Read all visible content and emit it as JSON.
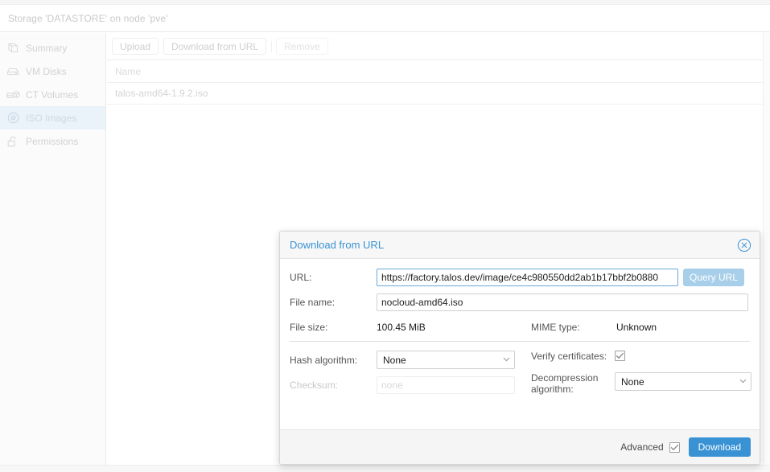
{
  "window": {
    "page_title": "Storage 'DATASTORE' on node 'pve'"
  },
  "sidebar": {
    "items": [
      {
        "label": "Summary",
        "icon": "summary-icon",
        "selected": false
      },
      {
        "label": "VM Disks",
        "icon": "harddrive-icon",
        "selected": false
      },
      {
        "label": "CT Volumes",
        "icon": "ct-volume-icon",
        "selected": false
      },
      {
        "label": "ISO Images",
        "icon": "disc-icon",
        "selected": true
      },
      {
        "label": "Permissions",
        "icon": "unlock-icon",
        "selected": false
      }
    ]
  },
  "toolbar": {
    "upload_label": "Upload",
    "download_url_label": "Download from URL",
    "remove_label": "Remove"
  },
  "table": {
    "columns": [
      "Name"
    ],
    "rows": [
      {
        "name": "talos-amd64-1.9.2.iso"
      }
    ]
  },
  "dialog": {
    "title": "Download from URL",
    "close_icon": "close-circle-icon",
    "url": {
      "label": "URL:",
      "value": "https://factory.talos.dev/image/ce4c980550dd2ab1b17bbf2b0880",
      "query_button": "Query URL"
    },
    "file_name": {
      "label": "File name:",
      "value": "nocloud-amd64.iso"
    },
    "file_size": {
      "label": "File size:",
      "value": "100.45 MiB"
    },
    "mime_type": {
      "label": "MIME type:",
      "value": "Unknown"
    },
    "hash_algorithm": {
      "label": "Hash algorithm:",
      "value": "None"
    },
    "checksum": {
      "label": "Checksum:",
      "placeholder": "none",
      "value": ""
    },
    "verify_certificates": {
      "label": "Verify certificates:",
      "checked": true
    },
    "decompression_algorithm": {
      "label": "Decompression algorithm:",
      "value": "None"
    },
    "footer": {
      "advanced_label": "Advanced",
      "advanced_checked": true,
      "download_label": "Download"
    }
  },
  "colors": {
    "accent": "#3892d4",
    "accent_light": "#a8cfe9",
    "selected_row": "#eaf2fa",
    "text": "#555555"
  }
}
